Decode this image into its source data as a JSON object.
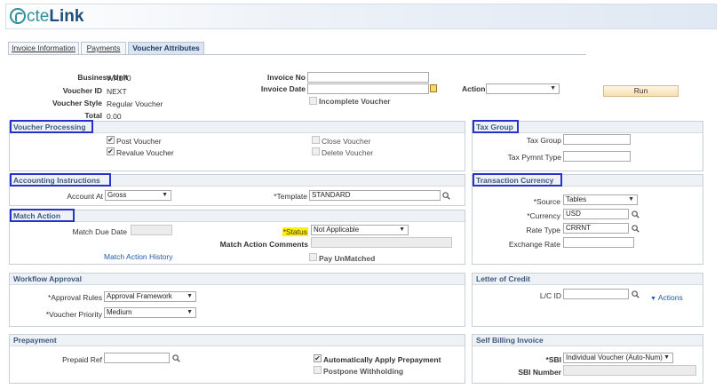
{
  "app": {
    "logo_prefix": "cte",
    "logo_suffix": "Link"
  },
  "tabs": [
    {
      "label": "Invoice Information",
      "active": false
    },
    {
      "label": "Payments",
      "active": false
    },
    {
      "label": "Voucher Attributes",
      "active": true
    }
  ],
  "summary": {
    "business_unit_label": "Business Unit",
    "business_unit": "WA170",
    "voucher_id_label": "Voucher ID",
    "voucher_id": "NEXT",
    "voucher_style_label": "Voucher Style",
    "voucher_style": "Regular Voucher",
    "total_label": "Total",
    "total": "0.00",
    "invoice_no_label": "Invoice No",
    "invoice_no": "",
    "invoice_date_label": "Invoice Date",
    "invoice_date": "",
    "incomplete_voucher_label": "Incomplete Voucher",
    "action_label": "Action",
    "action": "",
    "run_label": "Run"
  },
  "voucher_processing": {
    "title": "Voucher Processing",
    "post_voucher": "Post Voucher",
    "revalue_voucher": "Revalue Voucher",
    "close_voucher": "Close Voucher",
    "delete_voucher": "Delete Voucher"
  },
  "tax_group": {
    "title": "Tax Group",
    "tax_group_label": "Tax Group",
    "tax_group": "",
    "tax_pymnt_type_label": "Tax Pymnt Type",
    "tax_pymnt_type": ""
  },
  "accounting": {
    "title": "Accounting Instructions",
    "account_at_label": "Account At",
    "account_at": "Gross",
    "template_label": "*Template",
    "template": "STANDARD"
  },
  "match_action": {
    "title": "Match Action",
    "match_due_date_label": "Match Due Date",
    "match_due_date": "",
    "status_label": "*Status",
    "status": "Not Applicable",
    "comments_label": "Match Action Comments",
    "comments": "",
    "history_link": "Match Action History",
    "pay_unmatched": "Pay UnMatched"
  },
  "transaction_currency": {
    "title": "Transaction Currency",
    "source_label": "*Source",
    "source": "Tables",
    "currency_label": "*Currency",
    "currency": "USD",
    "rate_type_label": "Rate Type",
    "rate_type": "CRRNT",
    "exchange_rate_label": "Exchange Rate",
    "exchange_rate": ""
  },
  "workflow": {
    "title": "Workflow Approval",
    "approval_rules_label": "*Approval Rules",
    "approval_rules": "Approval Framework",
    "voucher_priority_label": "*Voucher Priority",
    "voucher_priority": "Medium"
  },
  "letter_of_credit": {
    "title": "Letter of Credit",
    "lc_id_label": "L/C ID",
    "lc_id": "",
    "actions_label": "Actions"
  },
  "prepayment": {
    "title": "Prepayment",
    "prepaid_ref_label": "Prepaid Ref",
    "prepaid_ref": "",
    "auto_apply": "Automatically Apply Prepayment",
    "postpone_withholding": "Postpone Withholding"
  },
  "self_billing": {
    "title": "Self Billing Invoice",
    "sbi_label": "*SBI",
    "sbi": "Individual Voucher (Auto-Num)",
    "sbi_number_label": "SBI Number",
    "sbi_number": ""
  },
  "colors": {
    "highlight_box": "#2533c8",
    "section_title": "#3a5a80",
    "status_highlight": "#fff200",
    "link": "#1f5ca8"
  }
}
